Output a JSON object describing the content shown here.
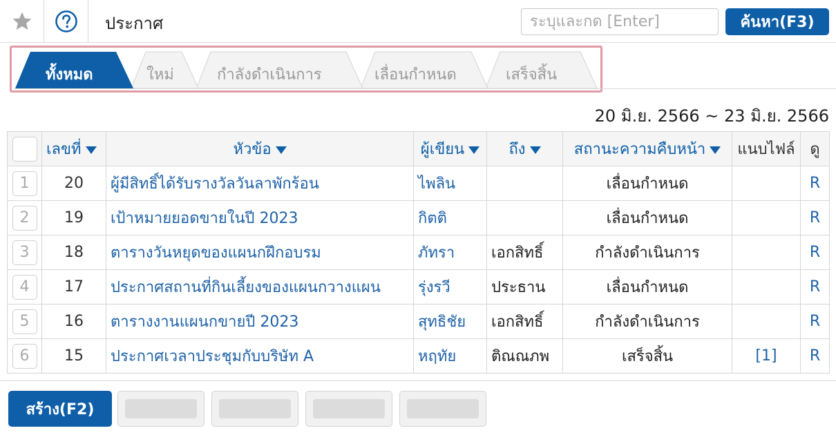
{
  "header": {
    "star_icon": "star-icon",
    "help_icon": "question-circle-icon",
    "title": "ประกาศ",
    "search_placeholder": "ระบุและกด [Enter]",
    "search_button": "ค้นหา(F3)"
  },
  "tabs": [
    {
      "label": "ทั้งหมด",
      "active": true
    },
    {
      "label": "ใหม่",
      "active": false
    },
    {
      "label": "กำลังดำเนินการ",
      "active": false
    },
    {
      "label": "เลื่อนกำหนด",
      "active": false
    },
    {
      "label": "เสร็จสิ้น",
      "active": false
    }
  ],
  "date_range": "20 มิ.ย. 2566 ~ 23 มิ.ย. 2566",
  "table": {
    "headers": {
      "number": "เลขที่",
      "subject": "หัวข้อ",
      "author": "ผู้เขียน",
      "to": "ถึง",
      "status": "สถานะความคืบหน้า",
      "attachment": "แนบไฟล์",
      "view": "ดู"
    },
    "rows": [
      {
        "idx": "1",
        "number": "20",
        "subject": "ผู้มีสิทธิ์ได้รับรางวัลวันลาพักร้อน",
        "author": "ไพลิน",
        "to": "",
        "status": "เลื่อนกำหนด",
        "attachment": "",
        "view": "R"
      },
      {
        "idx": "2",
        "number": "19",
        "subject": "เป้าหมายยอดขายในปี 2023",
        "author": "กิตติ",
        "to": "",
        "status": "เลื่อนกำหนด",
        "attachment": "",
        "view": "R"
      },
      {
        "idx": "3",
        "number": "18",
        "subject": "ตารางวันหยุดของแผนกฝึกอบรม",
        "author": "ภัทรา",
        "to": "เอกสิทธิ์",
        "status": "กำลังดำเนินการ",
        "attachment": "",
        "view": "R"
      },
      {
        "idx": "4",
        "number": "17",
        "subject": "ประกาศสถานที่กินเลี้ยงของแผนกวางแผน",
        "author": "รุ่งรวี",
        "to": "ประธาน",
        "status": "เลื่อนกำหนด",
        "attachment": "",
        "view": "R"
      },
      {
        "idx": "5",
        "number": "16",
        "subject": "ตารางงานแผนกขายปี 2023",
        "author": "สุทธิชัย",
        "to": "เอกสิทธิ์",
        "status": "กำลังดำเนินการ",
        "attachment": "",
        "view": "R"
      },
      {
        "idx": "6",
        "number": "15",
        "subject": "ประกาศเวลาประชุมกับบริษัท A",
        "author": "หฤทัย",
        "to": "ติณณภพ",
        "status": "เสร็จสิ้น",
        "attachment": "[1]",
        "view": "R"
      }
    ]
  },
  "footer": {
    "create_button": "สร้าง(F2)"
  },
  "colors": {
    "primary": "#0e5fa8",
    "link": "#1f62a8",
    "tab_highlight": "#e09aa6"
  }
}
